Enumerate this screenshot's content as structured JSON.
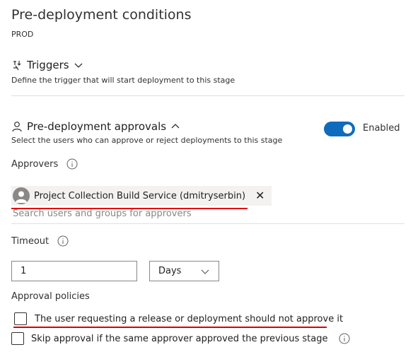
{
  "header": {
    "title": "Pre-deployment conditions",
    "stage": "PROD"
  },
  "triggers": {
    "label": "Triggers",
    "description": "Define the trigger that will start deployment to this stage",
    "icon": "trigger-icon"
  },
  "approvals": {
    "label": "Pre-deployment approvals",
    "description": "Select the users who can approve or reject deployments to this stage",
    "toggle_label": "Enabled",
    "enabled": true,
    "approvers_label": "Approvers",
    "approver_chip": "Project Collection Build Service (dmitryserbin)",
    "search_placeholder": "Search users and groups for approvers",
    "timeout_label": "Timeout",
    "timeout_value": "1",
    "timeout_unit": "Days",
    "policies_label": "Approval policies",
    "policy_1": "The user requesting a release or deployment should not approve it",
    "policy_2": "Skip approval if the same approver approved the previous stage"
  },
  "colors": {
    "accent": "#0f6cbd",
    "annotation_red": "#e00000"
  }
}
